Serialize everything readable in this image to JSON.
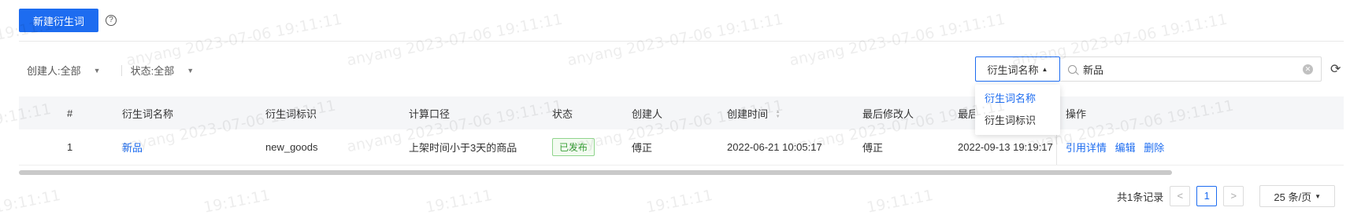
{
  "toolbar": {
    "new_button_label": "新建衍生词",
    "help_icon_glyph": "?"
  },
  "filters": {
    "creator": {
      "label": "创建人:",
      "value": "全部"
    },
    "status": {
      "label": "状态:",
      "value": "全部"
    }
  },
  "search": {
    "type_selected": "衍生词名称",
    "input_value": "新品",
    "type_options": [
      "衍生词名称",
      "衍生词标识"
    ]
  },
  "table": {
    "headers": {
      "index": "#",
      "name": "衍生词名称",
      "identifier": "衍生词标识",
      "formula": "计算口径",
      "status": "状态",
      "creator": "创建人",
      "created_at": "创建时间",
      "modifier": "最后修改人",
      "modified_at": "最后修改时间",
      "actions": "操作"
    },
    "rows": [
      {
        "index": "1",
        "name": "新品",
        "identifier": "new_goods",
        "formula": "上架时间小于3天的商品",
        "status": "已发布",
        "creator": "傅正",
        "created_at": "2022-06-21 10:05:17",
        "modifier": "傅正",
        "modified_at": "2022-09-13 19:19:17",
        "actions": {
          "detail": "引用详情",
          "edit": "编辑",
          "delete": "删除"
        }
      }
    ]
  },
  "pagination": {
    "total_text": "共1条记录",
    "prev": "<",
    "current_page": "1",
    "next": ">",
    "page_size": "25 条/页"
  },
  "watermark": {
    "text": "anyang 2023-07-06 19:11:11",
    "fragment": "19:11:11"
  },
  "colors": {
    "primary": "#1d6cf0",
    "published_text": "#3aa038"
  }
}
